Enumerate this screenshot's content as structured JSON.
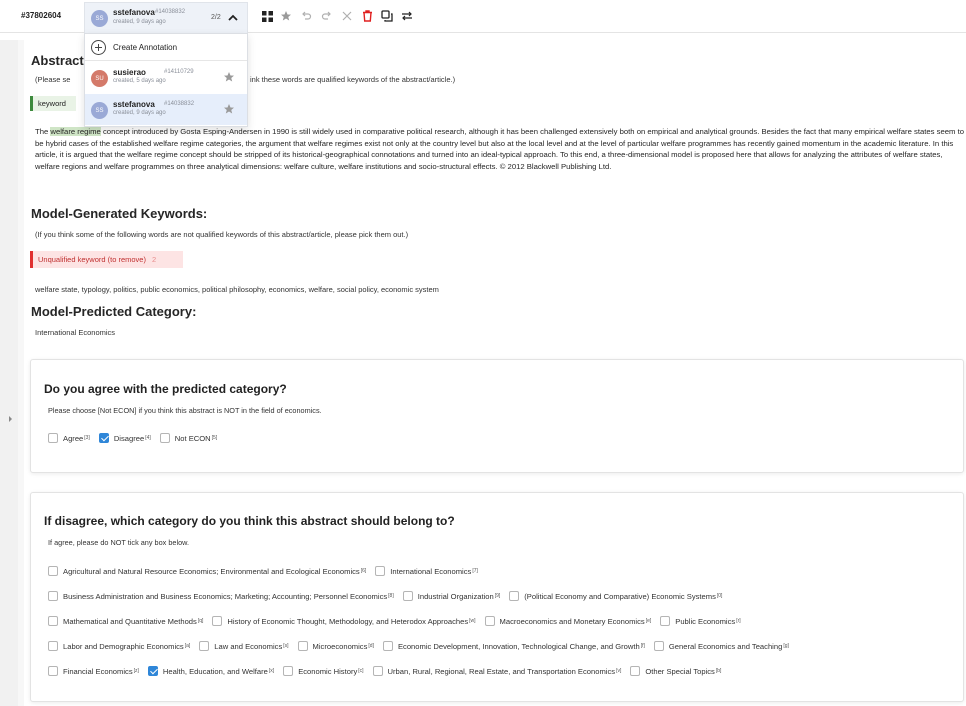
{
  "topbar": {
    "task_id": "#37802604",
    "current_user": {
      "initials": "SS",
      "name": "sstefanova",
      "id": "#14038832",
      "created": "created, 9 days ago"
    },
    "annotation_count": "2/2"
  },
  "dropdown": {
    "create_label": "Create Annotation",
    "items": [
      {
        "initials": "SU",
        "name": "susierao",
        "id": "#14110729",
        "created": "created, 5 days ago",
        "selected": false
      },
      {
        "initials": "SS",
        "name": "sstefanova",
        "id": "#14038832",
        "created": "created, 9 days ago",
        "selected": true
      }
    ]
  },
  "abstract_section": {
    "title": "Abstract",
    "instruction": "(Please se",
    "instruction_tail": "ink these words are qualified keywords of the abstract/article.)",
    "keyword_tag": "keyword",
    "highlight": "welfare regime",
    "text_before": "The ",
    "text_after": " concept introduced by Gosta Esping-Andersen in 1990 is still widely used in comparative political research, although it has been challenged extensively both on empirical and analytical grounds. Besides the fact that many empirical welfare states seem to be hybrid cases of the established welfare regime categories, the argument that welfare regimes exist not only at the country level but also at the local level and at the level of particular welfare programmes has recently gained momentum in the academic literature. In this article, it is argued that the welfare regime concept should be stripped of its historical-geographical connotations and turned into an ideal-typical approach. To this end, a three-dimensional model is proposed here that allows for analyzing the attributes of welfare states, welfare regions and welfare programmes on three analytical dimensions: welfare culture, welfare institutions and socio-structural effects. © 2012 Blackwell Publishing Ltd."
  },
  "keywords_section": {
    "title": "Model-Generated Keywords:",
    "instruction": "(If you think some of the following words are not qualified keywords of this abstract/article, please pick them out.)",
    "unqualified_label": "Unqualified keyword (to remove)",
    "unqualified_count": "2",
    "keywords": "welfare state, typology, politics, public economics, political philosophy, economics, welfare, social policy, economic system"
  },
  "category_section": {
    "title": "Model-Predicted Category:",
    "value": "International Economics"
  },
  "agree_card": {
    "title": "Do you agree with the predicted category?",
    "subtitle": "Please choose [Not ECON] if you think this abstract is NOT in the field of economics.",
    "options": [
      {
        "label": "Agree",
        "hotkey": "[3]",
        "checked": false
      },
      {
        "label": "Disagree",
        "hotkey": "[4]",
        "checked": true
      },
      {
        "label": "Not ECON",
        "hotkey": "[5]",
        "checked": false
      }
    ]
  },
  "disagree_card": {
    "title": "If disagree, which category do you think this abstract should belong to?",
    "subtitle": "If agree, please do NOT tick any box below.",
    "rows": [
      [
        {
          "label": "Agricultural and Natural Resource Economics; Environmental and Ecological Economics",
          "hotkey": "[6]",
          "checked": false
        },
        {
          "label": "International Economics",
          "hotkey": "[7]",
          "checked": false
        }
      ],
      [
        {
          "label": "Business Administration and Business Economics; Marketing; Accounting; Personnel Economics",
          "hotkey": "[8]",
          "checked": false
        },
        {
          "label": "Industrial Organization",
          "hotkey": "[9]",
          "checked": false
        },
        {
          "label": "(Political Economy and Comparative) Economic Systems",
          "hotkey": "[0]",
          "checked": false
        }
      ],
      [
        {
          "label": "Mathematical and Quantitative Methods",
          "hotkey": "[q]",
          "checked": false
        },
        {
          "label": "History of Economic Thought, Methodology, and Heterodox Approaches",
          "hotkey": "[w]",
          "checked": false
        },
        {
          "label": "Macroeconomics and Monetary Economics",
          "hotkey": "[e]",
          "checked": false
        },
        {
          "label": "Public Economics",
          "hotkey": "[r]",
          "checked": false
        }
      ],
      [
        {
          "label": "Labor and Demographic Economics",
          "hotkey": "[a]",
          "checked": false
        },
        {
          "label": "Law and Economics",
          "hotkey": "[s]",
          "checked": false
        },
        {
          "label": "Microeconomics",
          "hotkey": "[d]",
          "checked": false
        },
        {
          "label": "Economic Development, Innovation, Technological Change, and Growth",
          "hotkey": "[f]",
          "checked": false
        },
        {
          "label": "General Economics and Teaching",
          "hotkey": "[g]",
          "checked": false
        }
      ],
      [
        {
          "label": "Financial Economics",
          "hotkey": "[z]",
          "checked": false
        },
        {
          "label": "Health, Education, and Welfare",
          "hotkey": "[x]",
          "checked": true
        },
        {
          "label": "Economic History",
          "hotkey": "[c]",
          "checked": false
        },
        {
          "label": "Urban, Rural, Regional, Real Estate, and Transportation Economics",
          "hotkey": "[v]",
          "checked": false
        },
        {
          "label": "Other Special Topics",
          "hotkey": "[b]",
          "checked": false
        }
      ]
    ]
  },
  "colors": {
    "accent": "#2f86d8",
    "keyword_green": "#3d8a3d",
    "unqualified_red": "#e03030",
    "highlight": "#cfe5c6"
  },
  "icons": [
    "chevron-up-icon",
    "grid-icon",
    "star-icon",
    "undo-icon",
    "redo-icon",
    "close-icon",
    "trash-icon",
    "copy-icon",
    "swap-icon",
    "plus-circle-icon"
  ]
}
